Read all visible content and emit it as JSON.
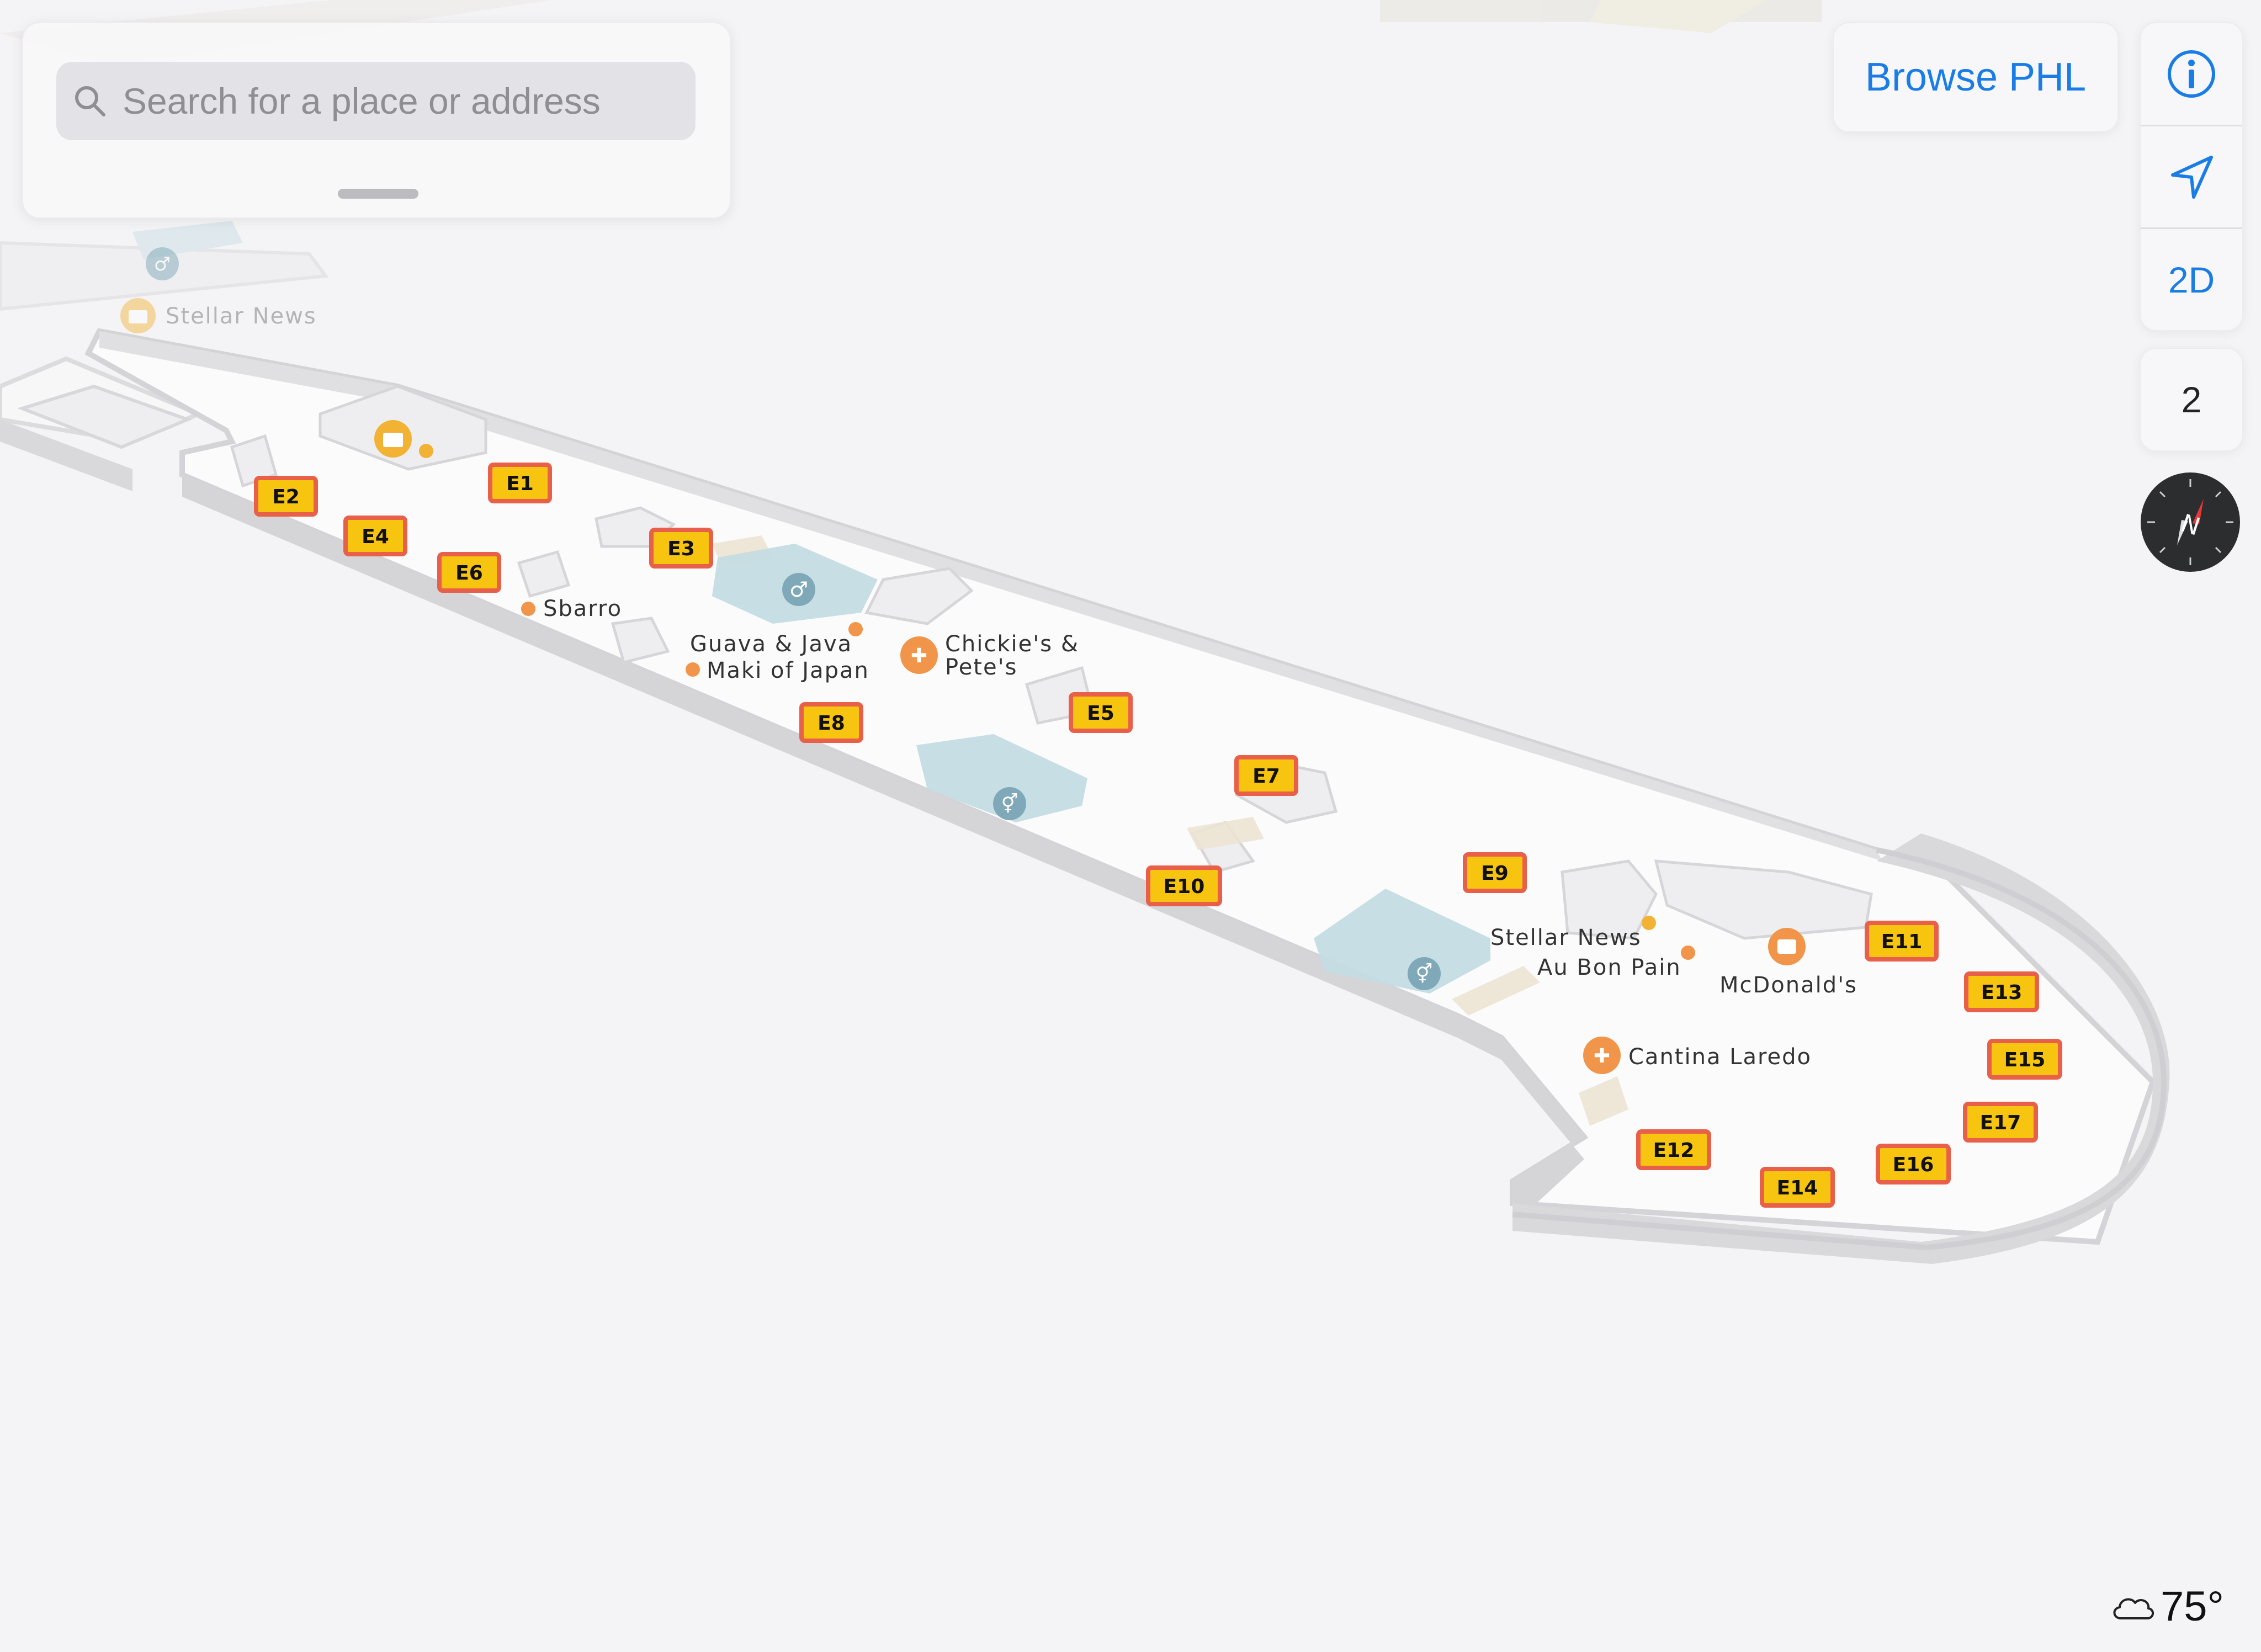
{
  "search": {
    "placeholder": "Search for a place or address"
  },
  "browse_button": {
    "label": "Browse PHL"
  },
  "controls": {
    "view_mode_label": "2D",
    "floor_label": "2"
  },
  "weather": {
    "temperature": "75°",
    "icon": "cloud-icon"
  },
  "map": {
    "faded_labels": [
      "Stellar News"
    ],
    "places": [
      {
        "name": "Sbarro",
        "kind": "poi"
      },
      {
        "name": "Guava & Java",
        "kind": "poi"
      },
      {
        "name": "Maki of Japan",
        "kind": "poi"
      },
      {
        "name": "Chickie's &",
        "kind": "restaurant"
      },
      {
        "name": "Pete's",
        "kind": "restaurant"
      },
      {
        "name": "Stellar News",
        "kind": "poi"
      },
      {
        "name": "Au Bon Pain",
        "kind": "poi"
      },
      {
        "name": "McDonald's",
        "kind": "restaurant"
      },
      {
        "name": "Cantina Laredo",
        "kind": "restaurant"
      }
    ],
    "gates": [
      "E1",
      "E2",
      "E3",
      "E4",
      "E5",
      "E6",
      "E7",
      "E8",
      "E9",
      "E10",
      "E11",
      "E12",
      "E13",
      "E14",
      "E15",
      "E16",
      "E17"
    ]
  },
  "colors": {
    "accent": "#1a7de6",
    "gate_fill": "#f7c410",
    "gate_border": "#e8604a",
    "restroom": "#aecfd8",
    "poi_dot": "#f0a030",
    "restaurant_dot": "#f0954a"
  }
}
